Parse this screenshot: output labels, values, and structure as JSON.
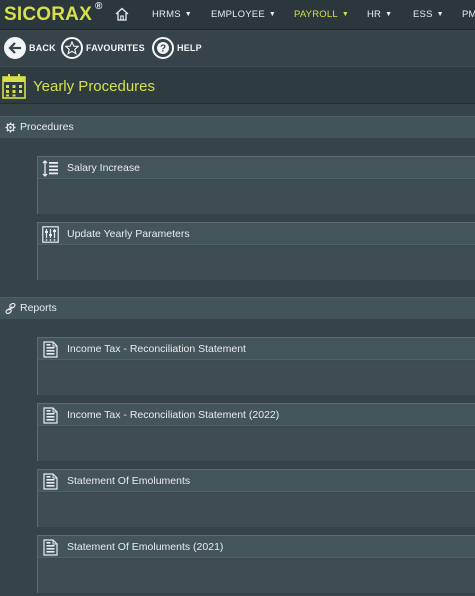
{
  "app": {
    "brand": "SICORAX",
    "brand_mark": "®"
  },
  "nav": {
    "items": [
      {
        "label": "HRMS",
        "caret": "▼",
        "active": false
      },
      {
        "label": "EMPLOYEE",
        "caret": "▼",
        "active": false
      },
      {
        "label": "PAYROLL",
        "caret": "▼",
        "active": true
      },
      {
        "label": "HR",
        "caret": "▼",
        "active": false
      },
      {
        "label": "ESS",
        "caret": "▼",
        "active": false
      },
      {
        "label": "PM",
        "caret": "",
        "active": false
      }
    ]
  },
  "actions": {
    "back": {
      "label": "BACK",
      "icon": "arrow-left-icon"
    },
    "favourites": {
      "label": "FAVOURITES",
      "icon": "star-icon"
    },
    "help": {
      "label": "HELP",
      "icon": "question-icon"
    }
  },
  "page": {
    "title": "Yearly Procedures",
    "icon": "calendar-icon"
  },
  "sections": {
    "procedures": {
      "title": "Procedures",
      "icon": "gear-icon",
      "items": [
        {
          "label": "Salary Increase",
          "icon": "sort-lines-icon"
        },
        {
          "label": "Update Yearly Parameters",
          "icon": "sliders-icon"
        }
      ]
    },
    "reports": {
      "title": "Reports",
      "icon": "link-icon",
      "items": [
        {
          "label": "Income Tax - Reconciliation Statement",
          "icon": "document-icon"
        },
        {
          "label": "Income Tax - Reconciliation Statement (2022)",
          "icon": "document-icon"
        },
        {
          "label": "Statement Of Emoluments",
          "icon": "document-icon"
        },
        {
          "label": "Statement Of Emoluments (2021)",
          "icon": "document-icon"
        }
      ]
    }
  },
  "colors": {
    "accent": "#d6e04a",
    "background": "#36444a",
    "topbar": "#2b373c",
    "section": "#43535a"
  }
}
